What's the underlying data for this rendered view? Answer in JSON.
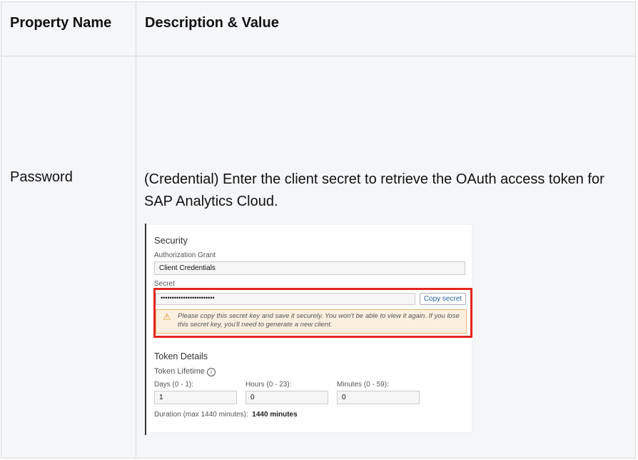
{
  "table": {
    "headers": [
      "Property Name",
      "Description & Value"
    ],
    "rows": [
      {
        "property": "Password",
        "description": "(Credential) Enter the client secret to retrieve the OAuth access token for SAP Analytics Cloud."
      }
    ]
  },
  "screenshot": {
    "security_title": "Security",
    "auth_grant_label": "Authorization Grant",
    "auth_grant_value": "Client Credentials",
    "secret_label": "Secret",
    "secret_value": "••••••••••••••••••••••••",
    "copy_button": "Copy secret",
    "warning_text": "Please copy this secret key and save it securely. You won't be able to view it again. If you lose this secret key, you'll need to generate a new client.",
    "token_title": "Token Details",
    "token_lifetime_label": "Token Lifetime",
    "days_label": "Days (0 - 1):",
    "days_value": "1",
    "hours_label": "Hours (0 - 23):",
    "hours_value": "0",
    "minutes_label": "Minutes (0 - 59):",
    "minutes_value": "0",
    "duration_label": "Duration (max 1440 minutes):",
    "duration_value": "1440 minutes",
    "highlight_color": "#e3261f"
  }
}
